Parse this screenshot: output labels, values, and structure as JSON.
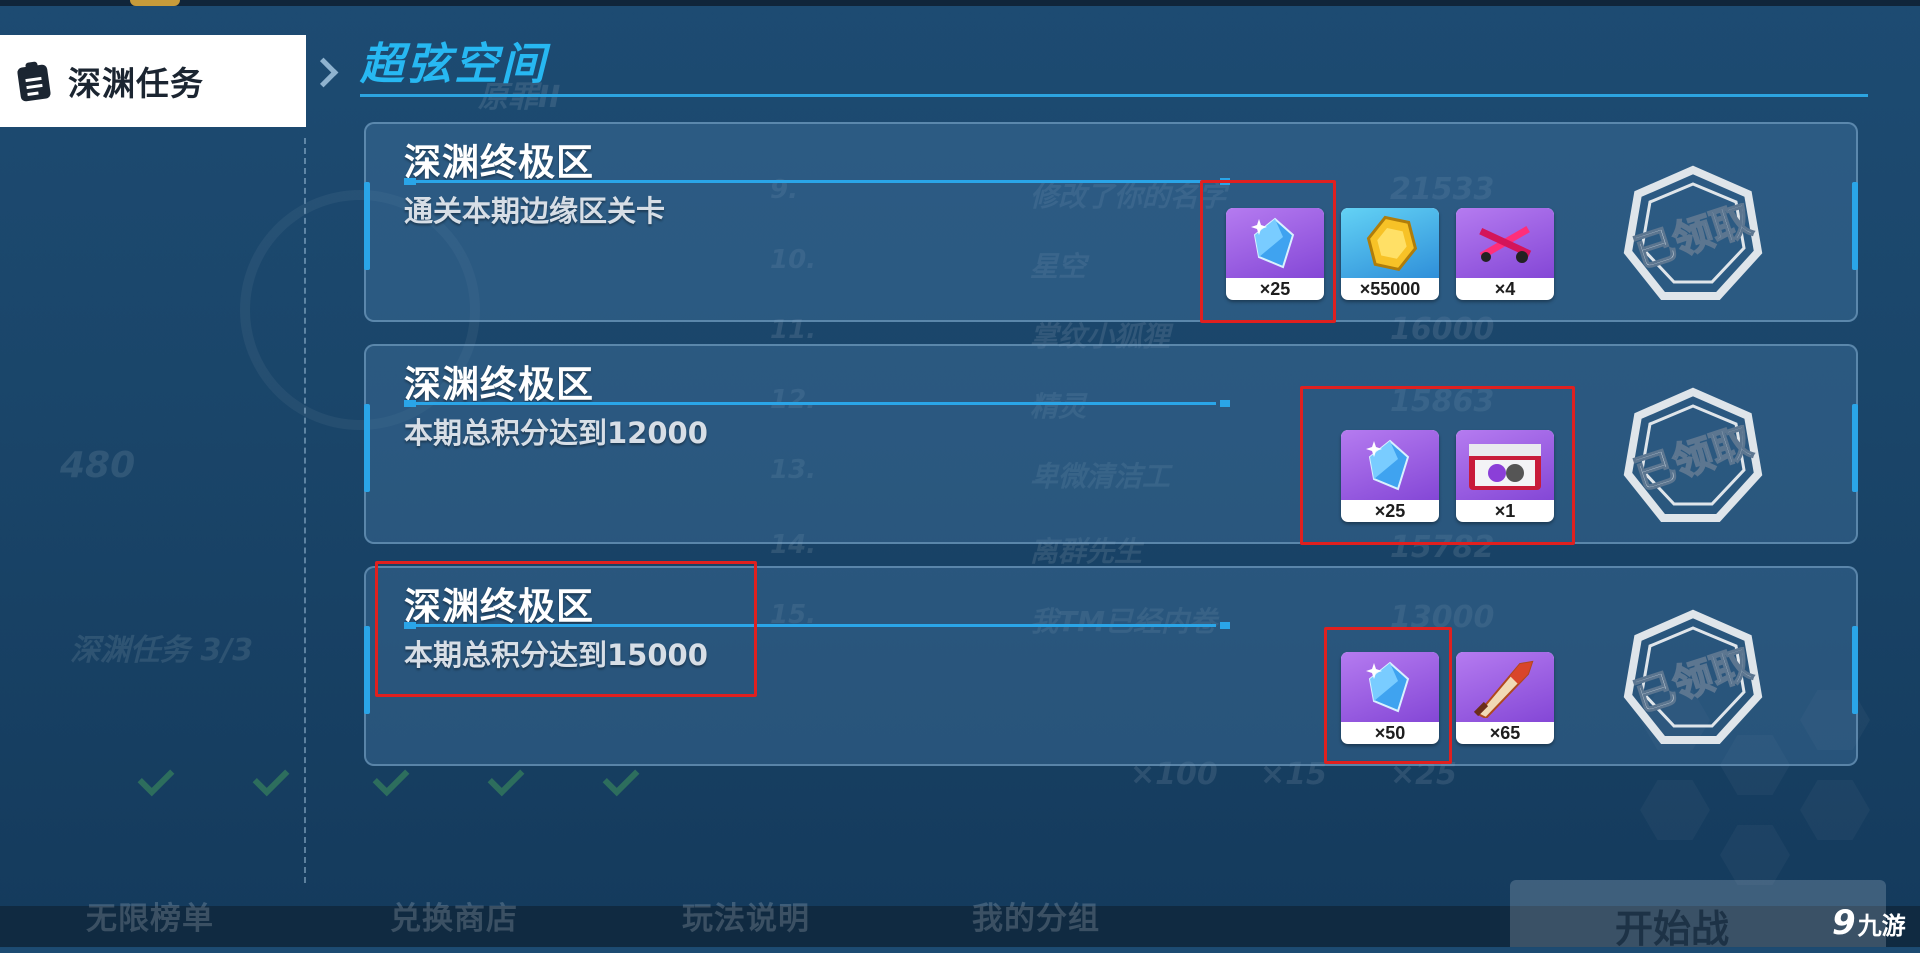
{
  "header": {
    "title": "超弦空间"
  },
  "sidebar": {
    "active_tab": "深渊任务"
  },
  "background_hints": {
    "ranking_title": "原罪II",
    "left_score": "480",
    "left_task": "深渊任务 3/3",
    "list_ranks": [
      "9.",
      "10.",
      "11.",
      "12.",
      "13.",
      "14.",
      "15."
    ],
    "list_names": [
      "修改了你的名字",
      "星空",
      "掌纹小狐狸",
      "精灵",
      "卑微清洁工",
      "离群先生",
      "我TM已经内卷"
    ],
    "list_scores": [
      "21533",
      "",
      "16000",
      "15863",
      "",
      "15782",
      "13000"
    ],
    "bonus_values": [
      "×100",
      "×15",
      "×25"
    ]
  },
  "missions": [
    {
      "name": "深渊终极区",
      "desc": "通关本期边缘区关卡",
      "status": "已领取",
      "rewards": [
        {
          "icon": "crystal-icon",
          "qty": "×25"
        },
        {
          "icon": "coin-icon",
          "qty": "×55000"
        },
        {
          "icon": "weapon-fragment-icon",
          "qty": "×4"
        }
      ]
    },
    {
      "name": "深渊终极区",
      "desc": "本期总积分达到12000",
      "status": "已领取",
      "rewards": [
        {
          "icon": "crystal-icon",
          "qty": "×25"
        },
        {
          "icon": "supply-box-icon",
          "qty": "×1"
        }
      ]
    },
    {
      "name": "深渊终极区",
      "desc": "本期总积分达到15000",
      "status": "已领取",
      "rewards": [
        {
          "icon": "crystal-icon",
          "qty": "×50"
        },
        {
          "icon": "blade-fragment-icon",
          "qty": "×65"
        }
      ]
    }
  ],
  "bottom_nav": {
    "tabs": [
      "无限榜单",
      "兑换商店",
      "玩法说明",
      "我的分组"
    ],
    "start_label": "开始战"
  },
  "watermark": {
    "number": "9",
    "text": "九游"
  },
  "colors": {
    "accent": "#27b8f2",
    "highlight": "#e0201f",
    "background": "#1d4b72"
  }
}
